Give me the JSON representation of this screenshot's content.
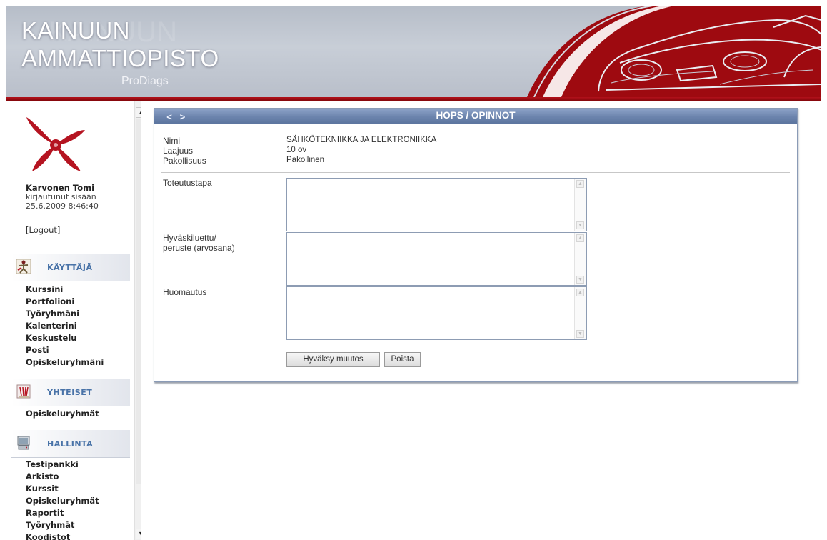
{
  "header": {
    "title_line1": "KAINUUN",
    "title_line2": "AMMATTIOPISTO",
    "subtitle": "ProDiags"
  },
  "sidebar": {
    "user": {
      "name": "Karvonen Tomi",
      "status": "kirjautunut sisään",
      "datetime": "25.6.2009 8:46:40"
    },
    "logout_label": "[Logout]",
    "sections": [
      {
        "title": "KÄYTTÄJÄ",
        "icon": "user-figure-icon",
        "items": [
          "Kurssini",
          "Portfolioni",
          "Työryhmäni",
          "Kalenterini",
          "Keskustelu",
          "Posti",
          "Opiskeluryhmäni"
        ]
      },
      {
        "title": "YHTEISET",
        "icon": "shared-folder-icon",
        "items": [
          "Opiskeluryhmät"
        ]
      },
      {
        "title": "HALLINTA",
        "icon": "admin-computer-icon",
        "items": [
          "Testipankki",
          "Arkisto",
          "Kurssit",
          "Opiskeluryhmät",
          "Raportit",
          "Työryhmät",
          "Koodistot"
        ]
      }
    ]
  },
  "panel": {
    "title": "HOPS / OPINNOT",
    "back_glyph": "<",
    "forward_glyph": ">",
    "info": {
      "nimi_label": "Nimi",
      "nimi_value": "SÄHKÖTEKNIIKKA JA ELEKTRONIIKKA",
      "laajuus_label": "Laajuus",
      "laajuus_value": "10 ov",
      "pakollisuus_label": "Pakollisuus",
      "pakollisuus_value": "Pakollinen"
    },
    "fields": {
      "toteutustapa_label": "Toteutustapa",
      "toteutustapa_value": "",
      "hyvaksiluettu_label_line1": "Hyväskiluettu/",
      "hyvaksiluettu_label_line2": "peruste (arvosana)",
      "hyvaksiluettu_value": "",
      "huomautus_label": "Huomautus",
      "huomautus_value": ""
    },
    "buttons": {
      "accept_label": "Hyväksy muutos",
      "delete_label": "Poista"
    }
  },
  "colors": {
    "header_bg": "#c4cad3",
    "header_red": "#9e0a10",
    "panel_title_bg": "#6c84ad",
    "section_title": "#4973a8"
  }
}
